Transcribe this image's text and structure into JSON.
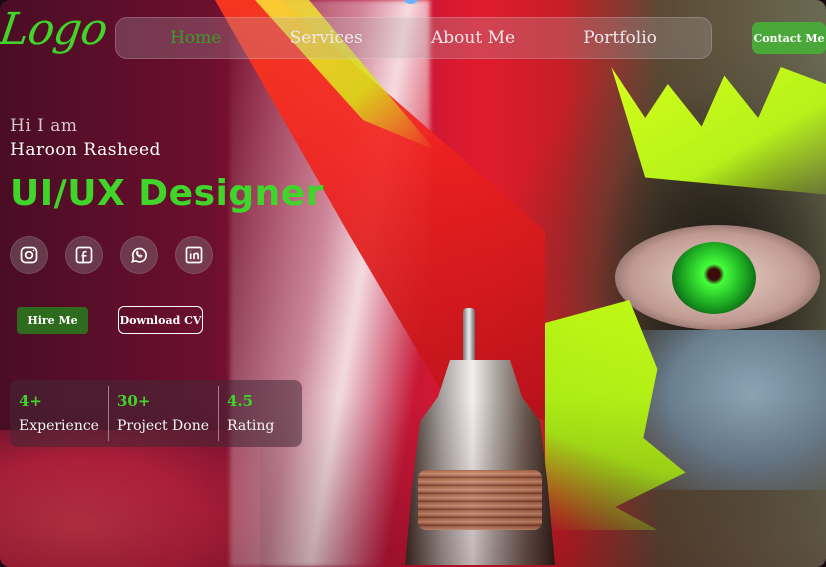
{
  "header": {
    "logo": "Logo",
    "nav": [
      {
        "label": "Home",
        "active": true
      },
      {
        "label": "Services",
        "active": false
      },
      {
        "label": "About Me",
        "active": false
      },
      {
        "label": "Portfolio",
        "active": false
      }
    ],
    "contact_label": "Contact Me"
  },
  "intro": {
    "greeting": "Hi I am",
    "name": "Haroon Rasheed",
    "role": "UI/UX Designer"
  },
  "socials": [
    {
      "icon": "instagram-icon"
    },
    {
      "icon": "facebook-icon"
    },
    {
      "icon": "whatsapp-icon"
    },
    {
      "icon": "linkedin-icon"
    }
  ],
  "actions": {
    "hire_label": "Hire Me",
    "download_label": "Download CV"
  },
  "stats": [
    {
      "value": "4+",
      "label": "Experience"
    },
    {
      "value": "30+",
      "label": "Project Done"
    },
    {
      "value": "4.5",
      "label": "Rating"
    }
  ],
  "colors": {
    "accent": "#3fd52a",
    "hire_button": "#2e6b1e",
    "contact_button": "#4aa83a"
  }
}
